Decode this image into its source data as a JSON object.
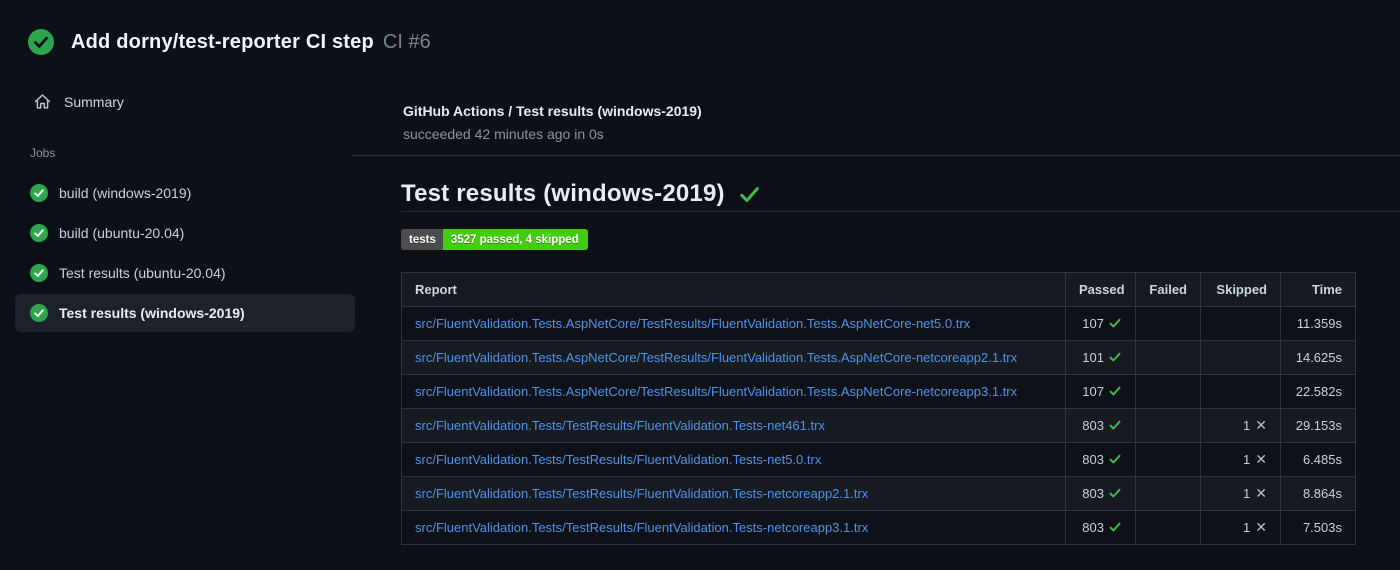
{
  "header": {
    "title": "Add dorny/test-reporter CI step",
    "run_number": "CI #6",
    "status": "success"
  },
  "sidebar": {
    "summary_label": "Summary",
    "jobs_label": "Jobs",
    "jobs": [
      {
        "label": "build (windows-2019)",
        "status": "success",
        "selected": false
      },
      {
        "label": "build (ubuntu-20.04)",
        "status": "success",
        "selected": false
      },
      {
        "label": "Test results (ubuntu-20.04)",
        "status": "success",
        "selected": false
      },
      {
        "label": "Test results (windows-2019)",
        "status": "success",
        "selected": true
      }
    ]
  },
  "job_header": {
    "title": "GitHub Actions / Test results (windows-2019)",
    "status_line": "succeeded 42 minutes ago in 0s"
  },
  "report": {
    "heading": "Test results (windows-2019)",
    "heading_status": "success",
    "badge": {
      "label": "tests",
      "value": "3527 passed, 4 skipped",
      "label_bg": "#4d4d4d",
      "value_bg": "#44cc11"
    },
    "table": {
      "columns": [
        "Report",
        "Passed",
        "Failed",
        "Skipped",
        "Time"
      ],
      "rows": [
        {
          "report": "src/FluentValidation.Tests.AspNetCore/TestResults/FluentValidation.Tests.AspNetCore-net5.0.trx",
          "passed": "107",
          "failed": "",
          "skipped": "",
          "time": "11.359s"
        },
        {
          "report": "src/FluentValidation.Tests.AspNetCore/TestResults/FluentValidation.Tests.AspNetCore-netcoreapp2.1.trx",
          "passed": "101",
          "failed": "",
          "skipped": "",
          "time": "14.625s"
        },
        {
          "report": "src/FluentValidation.Tests.AspNetCore/TestResults/FluentValidation.Tests.AspNetCore-netcoreapp3.1.trx",
          "passed": "107",
          "failed": "",
          "skipped": "",
          "time": "22.582s"
        },
        {
          "report": "src/FluentValidation.Tests/TestResults/FluentValidation.Tests-net461.trx",
          "passed": "803",
          "failed": "",
          "skipped": "1",
          "time": "29.153s"
        },
        {
          "report": "src/FluentValidation.Tests/TestResults/FluentValidation.Tests-net5.0.trx",
          "passed": "803",
          "failed": "",
          "skipped": "1",
          "time": "6.485s"
        },
        {
          "report": "src/FluentValidation.Tests/TestResults/FluentValidation.Tests-netcoreapp2.1.trx",
          "passed": "803",
          "failed": "",
          "skipped": "1",
          "time": "8.864s"
        },
        {
          "report": "src/FluentValidation.Tests/TestResults/FluentValidation.Tests-netcoreapp3.1.trx",
          "passed": "803",
          "failed": "",
          "skipped": "1",
          "time": "7.503s"
        }
      ]
    }
  },
  "colors": {
    "page_bg": "#0d1117",
    "success_green": "#2ea44f",
    "check_green": "#3fb950",
    "link_blue": "#4f93e8",
    "muted_text": "#8b949e",
    "border": "#30363d"
  }
}
